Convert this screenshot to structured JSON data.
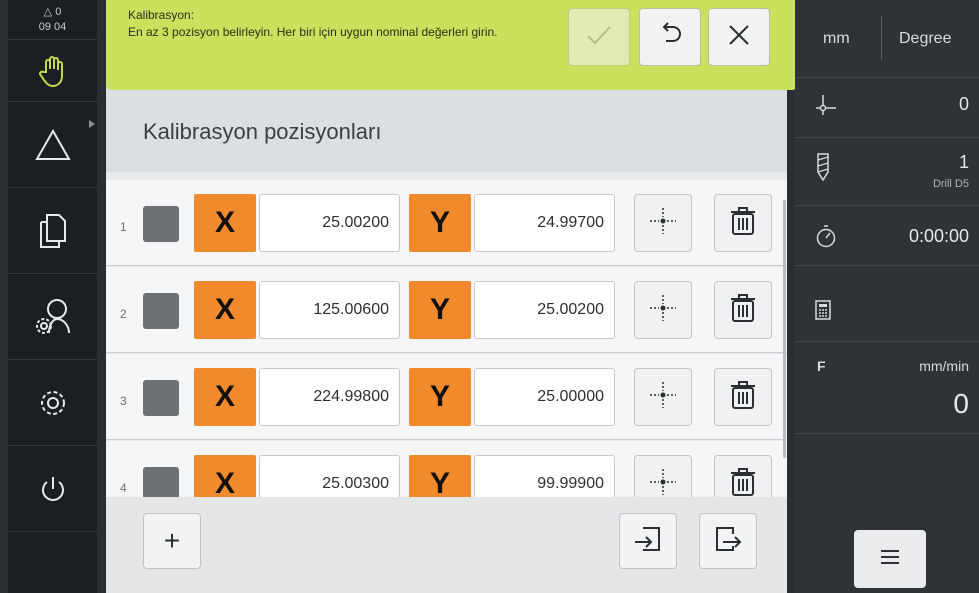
{
  "status": {
    "counter": "0",
    "time": "09 04"
  },
  "banner": {
    "title": "Kalibrasyon:",
    "message": "En az 3 pozisyon belirleyin. Her biri için uygun nominal değerleri girin."
  },
  "page": {
    "title": "Kalibrasyon pozisyonları"
  },
  "positions": [
    {
      "num": "1",
      "x_label": "X",
      "x": "25.00200",
      "y_label": "Y",
      "y": "24.99700"
    },
    {
      "num": "2",
      "x_label": "X",
      "x": "125.00600",
      "y_label": "Y",
      "y": "25.00200"
    },
    {
      "num": "3",
      "x_label": "X",
      "x": "224.99800",
      "y_label": "Y",
      "y": "25.00000"
    },
    {
      "num": "4",
      "x_label": "X",
      "x": "25.00300",
      "y_label": "Y",
      "y": "99.99900"
    }
  ],
  "footer": {
    "add_label": "+"
  },
  "right": {
    "unit_linear": "mm",
    "unit_angle": "Degree",
    "preset_value": "0",
    "tool_number": "1",
    "tool_name": "Drill D5",
    "timer": "0:00:00",
    "feed_label": "F",
    "feed_unit": "mm/min",
    "feed_value": "0"
  },
  "colors": {
    "banner": "#c9e15c",
    "axis": "#f08a2c",
    "sidebar": "#1c1f22",
    "hand_icon": "#c3d84f"
  },
  "icons": [
    "hand-icon",
    "delta-icon",
    "documents-icon",
    "user-settings-icon",
    "gear-icon",
    "power-icon",
    "check-icon",
    "undo-icon",
    "close-icon",
    "position-capture-icon",
    "trash-icon",
    "import-icon",
    "export-icon",
    "preset-icon",
    "drill-icon",
    "stopwatch-icon",
    "calculator-icon",
    "menu-icon"
  ]
}
